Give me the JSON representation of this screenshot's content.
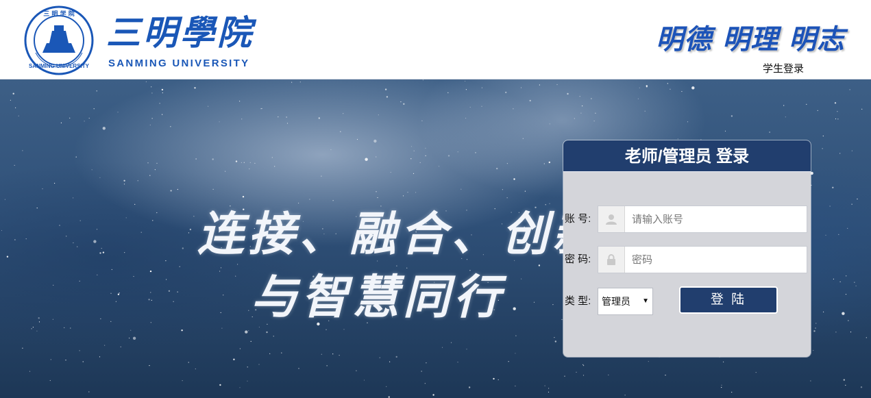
{
  "header": {
    "logo_seal_text": "三明学院 SANMING UNIVERSITY",
    "logo_cn": "三明學院",
    "logo_en": "SANMING UNIVERSITY",
    "motto": "明德 明理 明志",
    "student_login_link": "学生登录"
  },
  "hero": {
    "slogan_line1": "连接、融合、创新",
    "slogan_line2": "与智慧同行"
  },
  "login": {
    "title": "老师/管理员 登录",
    "account_label": "账 号:",
    "account_placeholder": "请输入账号",
    "password_label": "密 码:",
    "password_placeholder": "密码",
    "type_label": "类 型:",
    "type_selected": "管理员",
    "submit_label": "登 陆",
    "icons": {
      "account": "user-icon",
      "password": "lock-icon",
      "select": "caret-down-icon"
    }
  },
  "colors": {
    "brand_blue": "#1a57b7",
    "panel_header": "#213e6e",
    "panel_bg": "#d4d5da"
  }
}
